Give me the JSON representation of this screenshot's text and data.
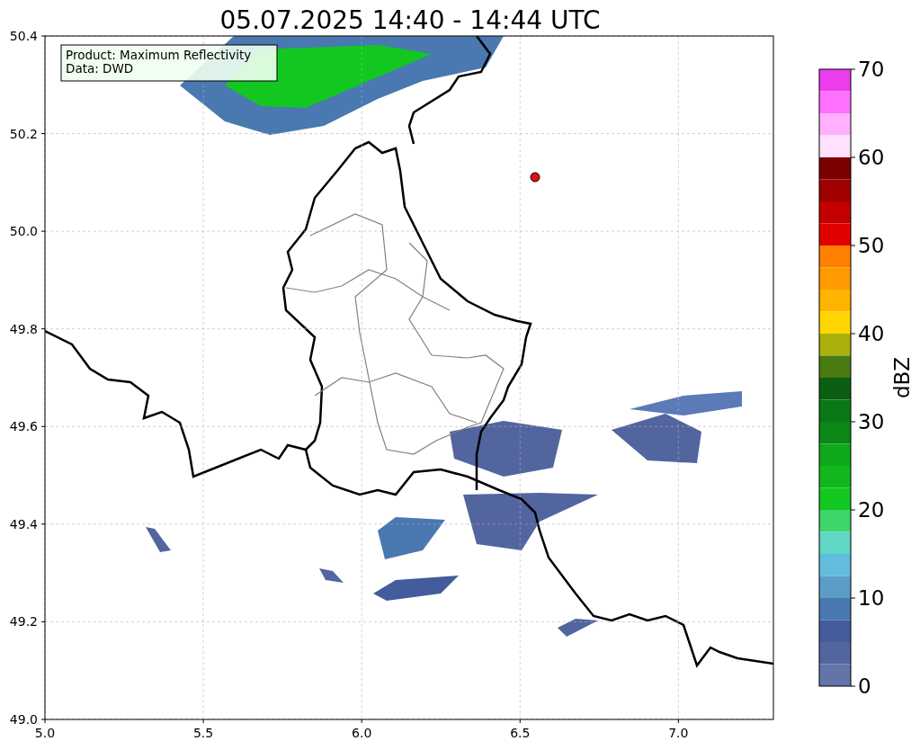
{
  "title": "05.07.2025 14:40 - 14:44 UTC",
  "info_box": {
    "lines": [
      "Product: Maximum Reflectivity",
      "Data: DWD"
    ]
  },
  "x_axis": {
    "ticks": [
      "5.0",
      "5.5",
      "6.0",
      "6.5",
      "7.0"
    ]
  },
  "y_axis": {
    "ticks": [
      "50.4",
      "50.2",
      "50.0",
      "49.8",
      "49.6",
      "49.4",
      "49.2",
      "49.0"
    ]
  },
  "colorbar": {
    "label": "dBZ",
    "ticks": [
      "70",
      "60",
      "50",
      "40",
      "30",
      "20",
      "10",
      "0"
    ],
    "bands": [
      {
        "color": "#ec3cec"
      },
      {
        "color": "#ff70ff"
      },
      {
        "color": "#ffb0ff"
      },
      {
        "color": "#ffe0ff"
      },
      {
        "color": "#7c0000"
      },
      {
        "color": "#a00000"
      },
      {
        "color": "#c40000"
      },
      {
        "color": "#e10000"
      },
      {
        "color": "#ff7f00"
      },
      {
        "color": "#ff9b00"
      },
      {
        "color": "#ffb400"
      },
      {
        "color": "#ffd600"
      },
      {
        "color": "#aab10d"
      },
      {
        "color": "#4a7a12"
      },
      {
        "color": "#0b5e12"
      },
      {
        "color": "#0a7816"
      },
      {
        "color": "#0b8817"
      },
      {
        "color": "#0ea81a"
      },
      {
        "color": "#10b81d"
      },
      {
        "color": "#12c820"
      },
      {
        "color": "#3ed46c"
      },
      {
        "color": "#60d6c6"
      },
      {
        "color": "#62bcdc"
      },
      {
        "color": "#5a9ec8"
      },
      {
        "color": "#4a78b0"
      },
      {
        "color": "#435c9d"
      },
      {
        "color": "#52659f"
      },
      {
        "color": "#6375a8"
      }
    ]
  }
}
